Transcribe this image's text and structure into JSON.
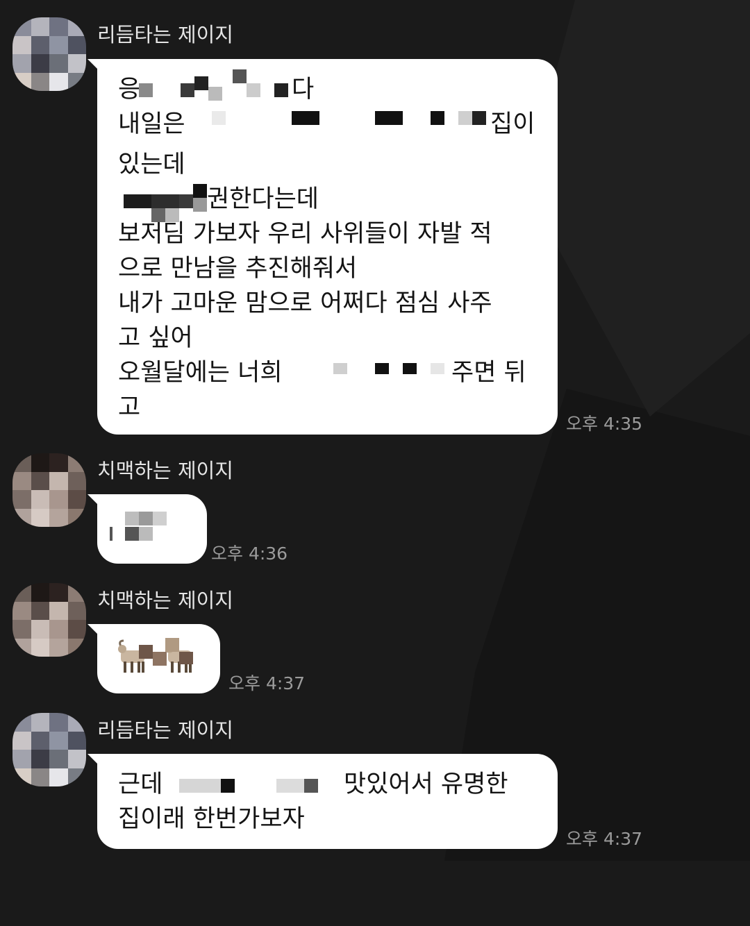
{
  "colors": {
    "background": "#1a1a1a",
    "bubble": "#ffffff",
    "sender_text": "#e6e6e6",
    "time_text": "#9b9b9b"
  },
  "messages": [
    {
      "sender": "리듬타는 제이지",
      "lines": [
        "응",
        "다",
        "내일은",
        "집이",
        "있는데",
        "권한다는데",
        "보저딤 가보자 우리 사위들이 자발 적",
        "으로 만남을 추진해줘서",
        "내가 고마운 맘으로 어쩌다 점심 사주",
        "고 싶어",
        "오월달에는 너희",
        "주면 뒤",
        "고"
      ],
      "time": "오후 4:35"
    },
    {
      "sender": "치맥하는 제이지",
      "lines": [],
      "time": "오후 4:36"
    },
    {
      "sender": "치맥하는 제이지",
      "lines": [],
      "emoji_icon": "goat-icon",
      "time": "오후 4:37"
    },
    {
      "sender": "리듬타는 제이지",
      "lines": [
        "근데",
        "맛있어서 유명한",
        "집이래  한번가보자"
      ],
      "time": "오후 4:37"
    }
  ]
}
